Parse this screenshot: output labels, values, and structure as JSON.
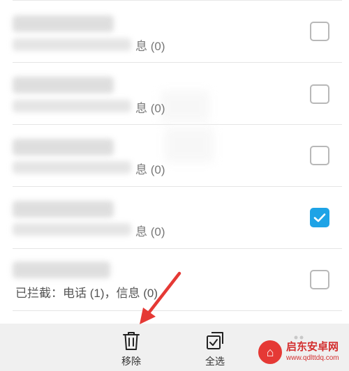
{
  "rows": [
    {
      "info": "息 (0)",
      "checked": false
    },
    {
      "info": "息 (0)",
      "checked": false
    },
    {
      "info": "息 (0)",
      "checked": false
    },
    {
      "info": "息 (0)",
      "checked": true
    },
    {
      "info": "已拦截：电话 (1)，信息 (0)",
      "checked": false
    }
  ],
  "bottom_bar": {
    "remove_label": "移除",
    "select_all_label": "全选"
  },
  "icons": {
    "remove": "trash-icon",
    "select_all": "select-all-icon",
    "more": "more-icon",
    "checkbox_checked": "checkmark-icon"
  },
  "colors": {
    "accent": "#1ea3e6",
    "arrow": "#e53935",
    "bottom_bar_bg": "#f0f0f0"
  },
  "watermark": {
    "title": "启东安卓网",
    "url": "www.qdlttdq.com"
  }
}
